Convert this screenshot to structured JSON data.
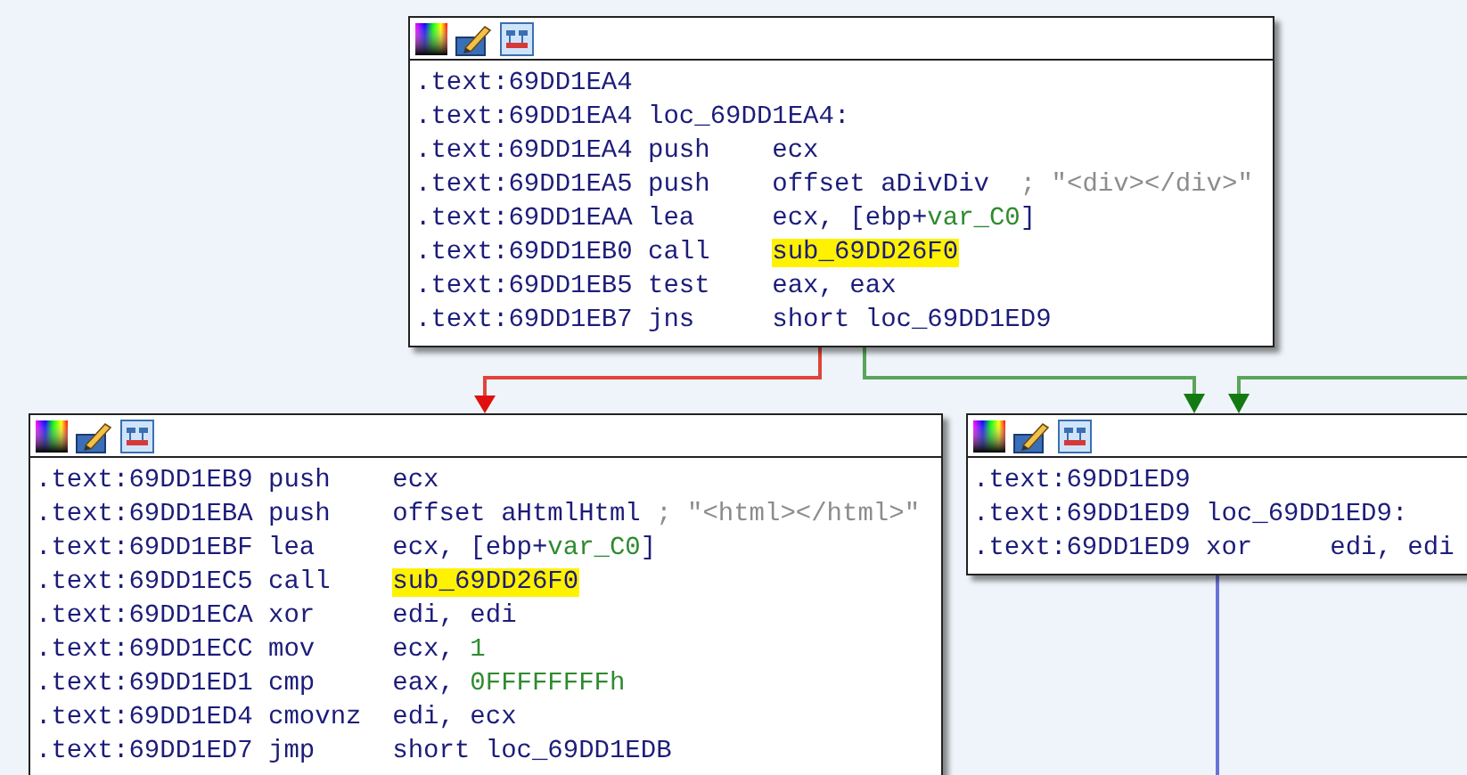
{
  "nodes": [
    {
      "lines": [
        {
          "address": ".text:69DD1EA4"
        },
        {
          "address": ".text:69DD1EA4",
          "label": "loc_69DD1EA4:"
        },
        {
          "address": ".text:69DD1EA4",
          "mnemonic": "push",
          "operands": [
            {
              "text": "ecx",
              "kind": "plain"
            }
          ]
        },
        {
          "address": ".text:69DD1EA5",
          "mnemonic": "push",
          "operands": [
            {
              "text": "offset aDivDiv",
              "kind": "plain"
            }
          ],
          "comment": "; \"<div></div>\""
        },
        {
          "address": ".text:69DD1EAA",
          "mnemonic": "lea",
          "operands": [
            {
              "text": "ecx, [ebp+",
              "kind": "plain"
            },
            {
              "text": "var_C0",
              "kind": "var"
            },
            {
              "text": "]",
              "kind": "plain"
            }
          ]
        },
        {
          "address": ".text:69DD1EB0",
          "mnemonic": "call",
          "operands": [
            {
              "text": "sub_69DD26F0",
              "kind": "highlighted"
            }
          ]
        },
        {
          "address": ".text:69DD1EB5",
          "mnemonic": "test",
          "operands": [
            {
              "text": "eax, eax",
              "kind": "plain"
            }
          ]
        },
        {
          "address": ".text:69DD1EB7",
          "mnemonic": "jns",
          "operands": [
            {
              "text": "short loc_69DD1ED9",
              "kind": "plain"
            }
          ]
        }
      ]
    },
    {
      "lines": [
        {
          "address": ".text:69DD1EB9",
          "mnemonic": "push",
          "operands": [
            {
              "text": "ecx",
              "kind": "plain"
            }
          ]
        },
        {
          "address": ".text:69DD1EBA",
          "mnemonic": "push",
          "operands": [
            {
              "text": "offset aHtmlHtml",
              "kind": "plain"
            }
          ],
          "comment": "; \"<html></html>\""
        },
        {
          "address": ".text:69DD1EBF",
          "mnemonic": "lea",
          "operands": [
            {
              "text": "ecx, [ebp+",
              "kind": "plain"
            },
            {
              "text": "var_C0",
              "kind": "var"
            },
            {
              "text": "]",
              "kind": "plain"
            }
          ]
        },
        {
          "address": ".text:69DD1EC5",
          "mnemonic": "call",
          "operands": [
            {
              "text": "sub_69DD26F0",
              "kind": "highlighted"
            }
          ]
        },
        {
          "address": ".text:69DD1ECA",
          "mnemonic": "xor",
          "operands": [
            {
              "text": "edi, edi",
              "kind": "plain"
            }
          ]
        },
        {
          "address": ".text:69DD1ECC",
          "mnemonic": "mov",
          "operands": [
            {
              "text": "ecx, ",
              "kind": "plain"
            },
            {
              "text": "1",
              "kind": "number"
            }
          ]
        },
        {
          "address": ".text:69DD1ED1",
          "mnemonic": "cmp",
          "operands": [
            {
              "text": "eax, ",
              "kind": "plain"
            },
            {
              "text": "0FFFFFFFFh",
              "kind": "number"
            }
          ]
        },
        {
          "address": ".text:69DD1ED4",
          "mnemonic": "cmovnz",
          "operands": [
            {
              "text": "edi, ecx",
              "kind": "plain"
            }
          ]
        },
        {
          "address": ".text:69DD1ED7",
          "mnemonic": "jmp",
          "operands": [
            {
              "text": "short loc_69DD1EDB",
              "kind": "plain"
            }
          ]
        }
      ]
    },
    {
      "lines": [
        {
          "address": ".text:69DD1ED9"
        },
        {
          "address": ".text:69DD1ED9",
          "label": "loc_69DD1ED9:"
        },
        {
          "address": ".text:69DD1ED9",
          "mnemonic": "xor",
          "operands": [
            {
              "text": "edi, edi",
              "kind": "plain"
            }
          ]
        }
      ]
    }
  ]
}
